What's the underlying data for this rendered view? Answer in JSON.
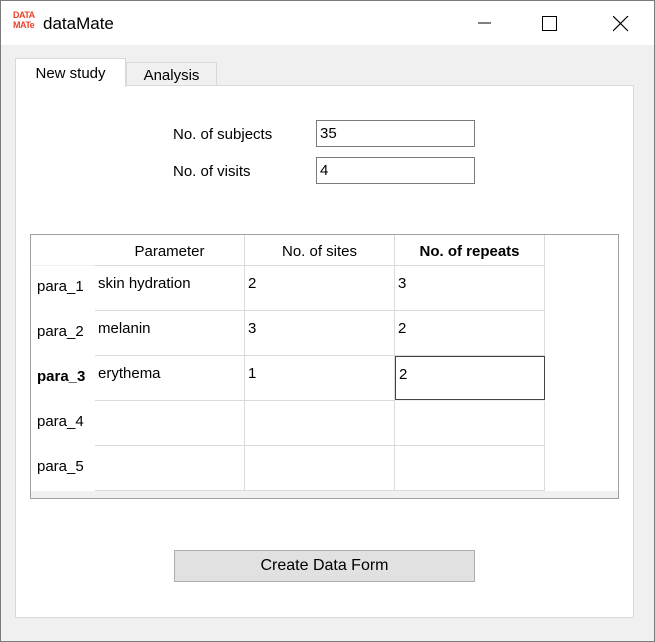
{
  "window": {
    "title": "dataMate",
    "logo": {
      "line1": "DATA",
      "line2": "MATe",
      "color": "#e8442a"
    }
  },
  "tabs": [
    {
      "label": "New study",
      "active": true
    },
    {
      "label": "Analysis",
      "active": false
    }
  ],
  "form": {
    "subjects_label": "No. of subjects",
    "subjects_value": "35",
    "visits_label": "No. of visits",
    "visits_value": "4"
  },
  "grid": {
    "headers": [
      "Parameter",
      "No. of sites",
      "No. of repeats"
    ],
    "rows": [
      {
        "label": "para_1",
        "cells": [
          "skin hydration",
          "2",
          "3"
        ]
      },
      {
        "label": "para_2",
        "cells": [
          "melanin",
          "3",
          "2"
        ]
      },
      {
        "label": "para_3",
        "cells": [
          "erythema",
          "1",
          "2"
        ]
      },
      {
        "label": "para_4",
        "cells": [
          "",
          "",
          ""
        ]
      },
      {
        "label": "para_5",
        "cells": [
          "",
          "",
          ""
        ]
      }
    ]
  },
  "actions": {
    "create_label": "Create Data Form"
  }
}
